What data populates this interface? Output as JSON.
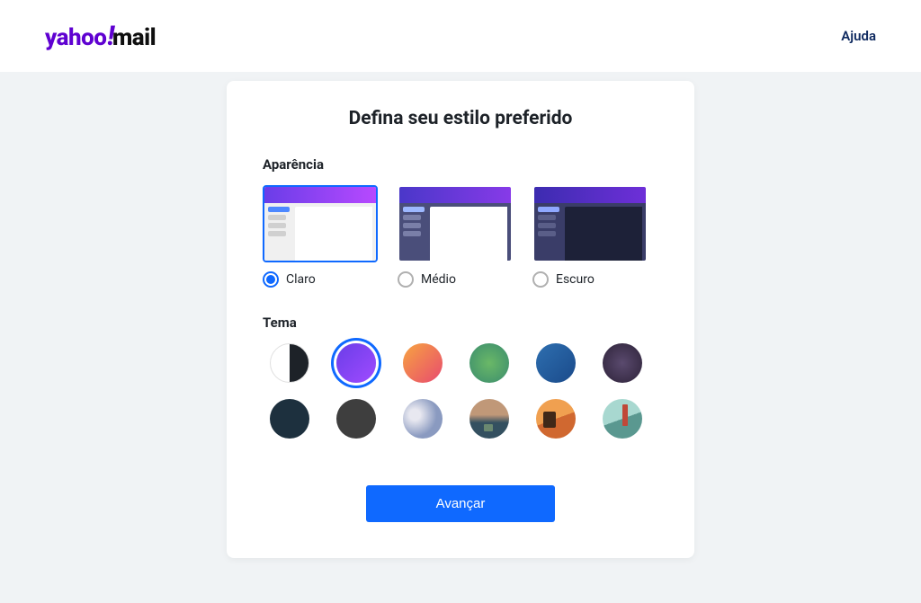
{
  "header": {
    "logo_yahoo": "yahoo",
    "logo_excl": "!",
    "logo_mail": "mail",
    "help_label": "Ajuda"
  },
  "card": {
    "title": "Defina seu estilo preferido",
    "appearance_label": "Aparência",
    "appearance_options": [
      {
        "label": "Claro",
        "selected": true
      },
      {
        "label": "Médio",
        "selected": false
      },
      {
        "label": "Escuro",
        "selected": false
      }
    ],
    "theme_label": "Tema",
    "themes": [
      {
        "name": "black-white",
        "selected": false
      },
      {
        "name": "purple-gradient",
        "selected": true
      },
      {
        "name": "orange-pink",
        "selected": false
      },
      {
        "name": "green",
        "selected": false
      },
      {
        "name": "blue",
        "selected": false
      },
      {
        "name": "dark-purple",
        "selected": false
      },
      {
        "name": "navy",
        "selected": false
      },
      {
        "name": "charcoal",
        "selected": false
      },
      {
        "name": "mountains",
        "selected": false
      },
      {
        "name": "desert",
        "selected": false
      },
      {
        "name": "sunset",
        "selected": false
      },
      {
        "name": "lighthouse",
        "selected": false
      }
    ],
    "submit_label": "Avançar"
  }
}
